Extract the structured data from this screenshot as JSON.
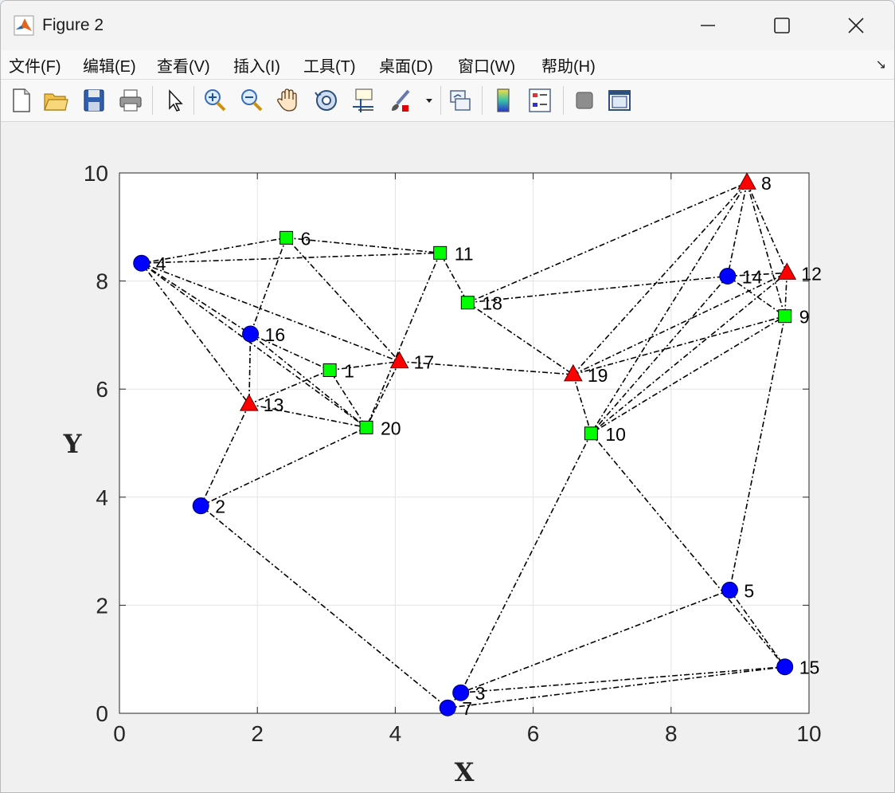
{
  "window": {
    "title": "Figure 2",
    "minimize_icon": "minimize-icon",
    "maximize_icon": "maximize-icon",
    "close_icon": "close-icon"
  },
  "menu": {
    "items": [
      "文件(F)",
      "编辑(E)",
      "查看(V)",
      "插入(I)",
      "工具(T)",
      "桌面(D)",
      "窗口(W)",
      "帮助(H)"
    ],
    "dock_icon": "dock-arrow-icon"
  },
  "toolbar": {
    "buttons": [
      "new-figure-icon",
      "open-file-icon",
      "save-icon",
      "print-icon",
      "select-pointer-icon",
      "zoom-in-icon",
      "zoom-out-icon",
      "pan-hand-icon",
      "rotate-3d-icon",
      "data-cursor-icon",
      "brush-icon",
      "link-plot-icon",
      "colorbar-icon",
      "legend-icon",
      "hide-tools-icon",
      "show-tools-icon"
    ]
  },
  "chart_data": {
    "type": "scatter",
    "xlabel": "X",
    "ylabel": "Y",
    "xlim": [
      0,
      10
    ],
    "ylim": [
      0,
      10
    ],
    "xticks": [
      0,
      2,
      4,
      6,
      8,
      10
    ],
    "yticks": [
      0,
      2,
      4,
      6,
      8,
      10
    ],
    "grid": true,
    "colors": {
      "circle": "#0000ff",
      "square": "#00ff00",
      "triangle": "#ff0000",
      "edge": "#000000"
    },
    "nodes": [
      {
        "id": "1",
        "x": 3.05,
        "y": 6.35,
        "shape": "square"
      },
      {
        "id": "2",
        "x": 1.18,
        "y": 3.84,
        "shape": "circle"
      },
      {
        "id": "3",
        "x": 4.95,
        "y": 0.38,
        "shape": "circle"
      },
      {
        "id": "4",
        "x": 0.32,
        "y": 8.33,
        "shape": "circle"
      },
      {
        "id": "5",
        "x": 8.85,
        "y": 2.28,
        "shape": "circle"
      },
      {
        "id": "6",
        "x": 2.42,
        "y": 8.8,
        "shape": "square"
      },
      {
        "id": "7",
        "x": 4.76,
        "y": 0.1,
        "shape": "circle"
      },
      {
        "id": "8",
        "x": 9.1,
        "y": 9.82,
        "shape": "triangle"
      },
      {
        "id": "9",
        "x": 9.65,
        "y": 7.35,
        "shape": "square"
      },
      {
        "id": "10",
        "x": 6.84,
        "y": 5.18,
        "shape": "square"
      },
      {
        "id": "11",
        "x": 4.65,
        "y": 8.52,
        "shape": "square"
      },
      {
        "id": "12",
        "x": 9.68,
        "y": 8.15,
        "shape": "triangle"
      },
      {
        "id": "13",
        "x": 1.88,
        "y": 5.72,
        "shape": "triangle"
      },
      {
        "id": "14",
        "x": 8.82,
        "y": 8.09,
        "shape": "circle"
      },
      {
        "id": "15",
        "x": 9.65,
        "y": 0.86,
        "shape": "circle"
      },
      {
        "id": "16",
        "x": 1.9,
        "y": 7.02,
        "shape": "circle"
      },
      {
        "id": "17",
        "x": 4.06,
        "y": 6.51,
        "shape": "triangle"
      },
      {
        "id": "18",
        "x": 5.05,
        "y": 7.6,
        "shape": "square"
      },
      {
        "id": "19",
        "x": 6.58,
        "y": 6.27,
        "shape": "triangle"
      },
      {
        "id": "20",
        "x": 3.58,
        "y": 5.29,
        "shape": "square"
      }
    ],
    "edges": [
      [
        "4",
        "6"
      ],
      [
        "4",
        "11"
      ],
      [
        "4",
        "16"
      ],
      [
        "4",
        "13"
      ],
      [
        "4",
        "17"
      ],
      [
        "4",
        "20"
      ],
      [
        "6",
        "11"
      ],
      [
        "6",
        "16"
      ],
      [
        "6",
        "17"
      ],
      [
        "11",
        "18"
      ],
      [
        "11",
        "20"
      ],
      [
        "16",
        "13"
      ],
      [
        "16",
        "1"
      ],
      [
        "16",
        "20"
      ],
      [
        "1",
        "17"
      ],
      [
        "1",
        "13"
      ],
      [
        "1",
        "20"
      ],
      [
        "13",
        "20"
      ],
      [
        "13",
        "2"
      ],
      [
        "2",
        "20"
      ],
      [
        "2",
        "7"
      ],
      [
        "17",
        "19"
      ],
      [
        "17",
        "20"
      ],
      [
        "18",
        "8"
      ],
      [
        "18",
        "14"
      ],
      [
        "18",
        "19"
      ],
      [
        "19",
        "10"
      ],
      [
        "19",
        "8"
      ],
      [
        "19",
        "12"
      ],
      [
        "19",
        "9"
      ],
      [
        "10",
        "8"
      ],
      [
        "10",
        "12"
      ],
      [
        "10",
        "14"
      ],
      [
        "10",
        "9"
      ],
      [
        "10",
        "3"
      ],
      [
        "10",
        "15"
      ],
      [
        "8",
        "14"
      ],
      [
        "8",
        "12"
      ],
      [
        "8",
        "9"
      ],
      [
        "14",
        "12"
      ],
      [
        "14",
        "9"
      ],
      [
        "12",
        "9"
      ],
      [
        "9",
        "5"
      ],
      [
        "5",
        "15"
      ],
      [
        "5",
        "3"
      ],
      [
        "15",
        "3"
      ],
      [
        "15",
        "7"
      ],
      [
        "3",
        "7"
      ]
    ]
  }
}
